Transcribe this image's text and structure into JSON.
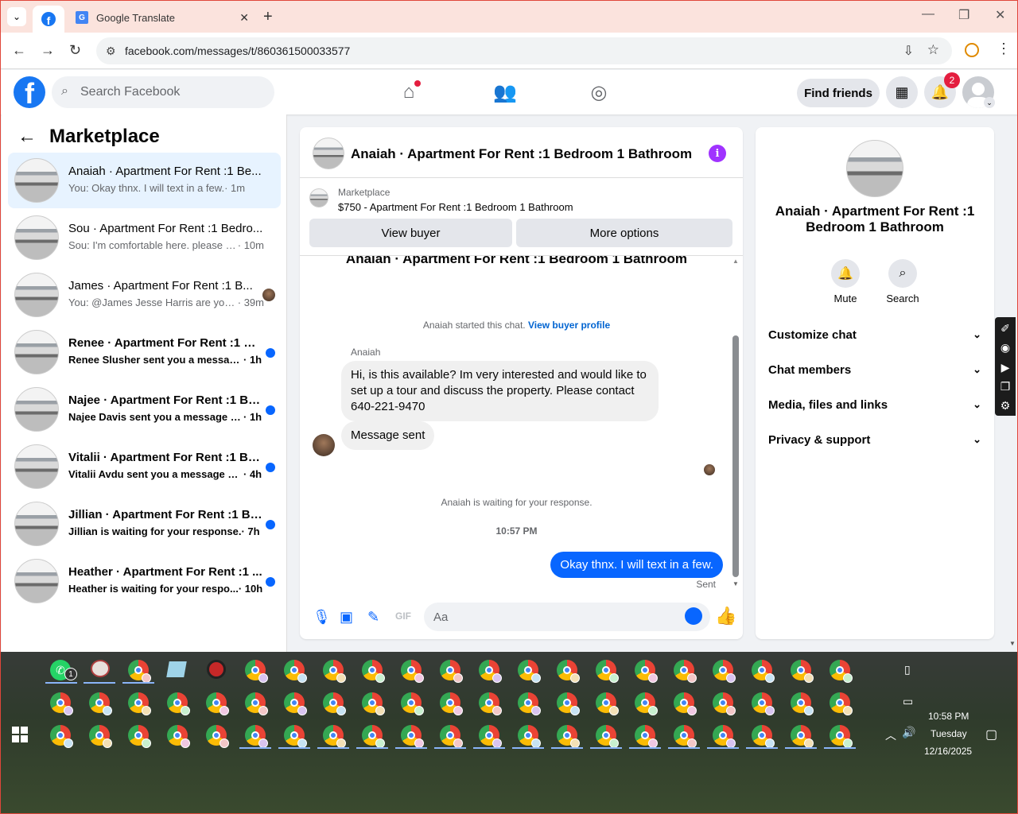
{
  "browser": {
    "tab_title": "Google Translate",
    "url": "facebook.com/messages/t/860361500033577"
  },
  "fb": {
    "search_placeholder": "Search Facebook",
    "find_friends": "Find friends",
    "notif_count": "2"
  },
  "left": {
    "header": "Marketplace",
    "conversations": [
      {
        "title": "Anaiah · Apartment For Rent :1 Be...",
        "preview": "You: Okay thnx. I will text in a few.",
        "time": "· 1m",
        "unread": false
      },
      {
        "title": "Sou · Apartment For Rent :1 Bedro...",
        "preview": "Sou: I'm comfortable here. please se...",
        "time": "· 10m",
        "unread": false
      },
      {
        "title": "James · Apartment For Rent :1 B...",
        "preview": "You: @James Jesse Harris are you...",
        "time": "· 39m",
        "unread": false
      },
      {
        "title": "Renee · Apartment For Rent :1 Be...",
        "preview": "Renee Slusher sent you a message ...",
        "time": "· 1h",
        "unread": true
      },
      {
        "title": "Najee · Apartment For Rent :1 Be...",
        "preview": "Najee Davis sent you a message a...",
        "time": "· 1h",
        "unread": true
      },
      {
        "title": "Vitalii · Apartment For Rent :1 Be...",
        "preview": "Vitalii Avdu sent you a message ab...",
        "time": "· 4h",
        "unread": true
      },
      {
        "title": "Jillian · Apartment For Rent :1 Be...",
        "preview": "Jillian is waiting for your response.",
        "time": "· 7h",
        "unread": true
      },
      {
        "title": "Heather · Apartment For Rent :1 ...",
        "preview": "Heather is waiting for your respo...",
        "time": "· 10h",
        "unread": true
      }
    ]
  },
  "chat": {
    "title": "Anaiah · Apartment For Rent :1 Bedroom 1 Bathroom",
    "marketplace_label": "Marketplace",
    "listing": "$750 - Apartment For Rent :1 Bedroom 1 Bathroom",
    "view_buyer": "View buyer",
    "more_options": "More options",
    "cut_title": "Anaiah · Apartment For Rent :1 Bedroom 1 Bathroom",
    "started": "Anaiah started this chat.",
    "view_profile": "View buyer profile",
    "sender": "Anaiah",
    "msg1": "Hi, is this available? Im very interested and would like to set up a tour and discuss the property. Please contact 640-221-9470",
    "msg2": "Message sent",
    "waiting": "Anaiah is waiting for your response.",
    "timestamp": "10:57 PM",
    "my_msg": "Okay thnx. I will text in a few.",
    "sent_label": "Sent",
    "input_placeholder": "Aa"
  },
  "right": {
    "title": "Anaiah · Apartment For Rent :1 Bedroom 1 Bathroom",
    "mute": "Mute",
    "search": "Search",
    "sections": [
      "Customize chat",
      "Chat members",
      "Media, files and links",
      "Privacy & support"
    ]
  },
  "taskbar": {
    "time": "10:58 PM",
    "day": "Tuesday",
    "date": "12/16/2025",
    "wa_badge": "1"
  }
}
